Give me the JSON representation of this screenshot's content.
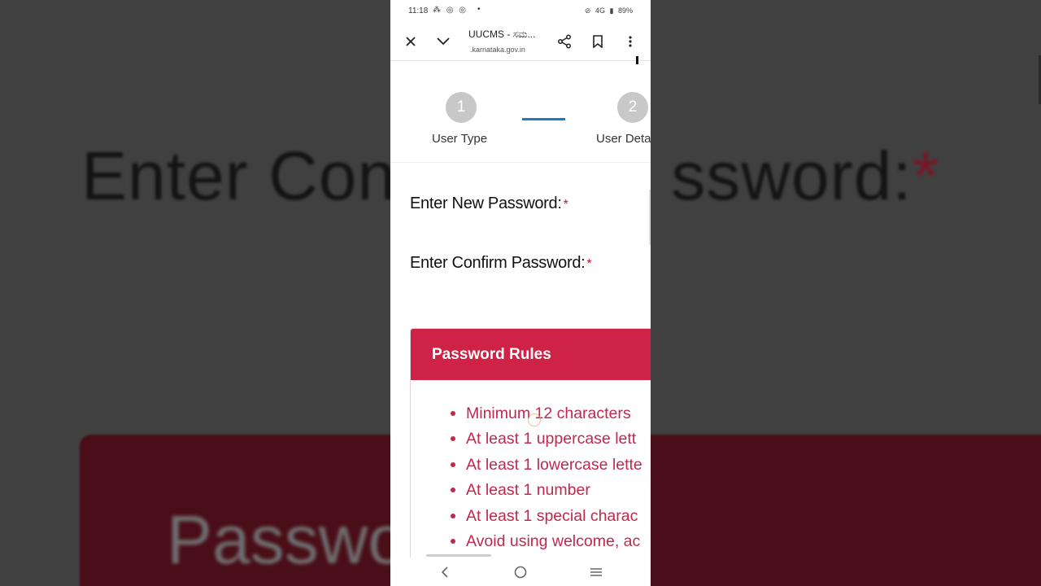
{
  "background": {
    "zoom_label_text": "Enter Con",
    "zoom_label_text_2": "ssword:",
    "zoom_required": "*",
    "zoom_card_text": "Passwo"
  },
  "status_bar": {
    "time": "11:18",
    "right_text": "4G",
    "battery": "89%"
  },
  "browser": {
    "title": "UUCMS - ಸಮ...",
    "url": ".karnataka.gov.in"
  },
  "stepper": {
    "steps": [
      {
        "number": "1",
        "label": "User Type"
      },
      {
        "number": "2",
        "label": "User Deta"
      }
    ]
  },
  "form": {
    "new_password_label": "Enter New Password:",
    "confirm_password_label": "Enter Confirm Password:",
    "required_marker": "*"
  },
  "password_rules": {
    "title": "Password Rules",
    "items": [
      "Minimum 12 characters",
      "At least 1 uppercase lett",
      "At least 1 lowercase lette",
      "At least 1 number",
      "At least 1 special charac",
      "Avoid using welcome, ac"
    ]
  },
  "colors": {
    "accent": "#cf2247",
    "rule_text": "#c0284e",
    "step_connector": "#1e7dc0",
    "step_circle": "#c8c8c8"
  },
  "icons": [
    "close-icon",
    "chevron-down-icon",
    "share-icon",
    "bookmark-icon",
    "more-vert-icon",
    "back-icon",
    "home-icon",
    "recents-icon"
  ]
}
